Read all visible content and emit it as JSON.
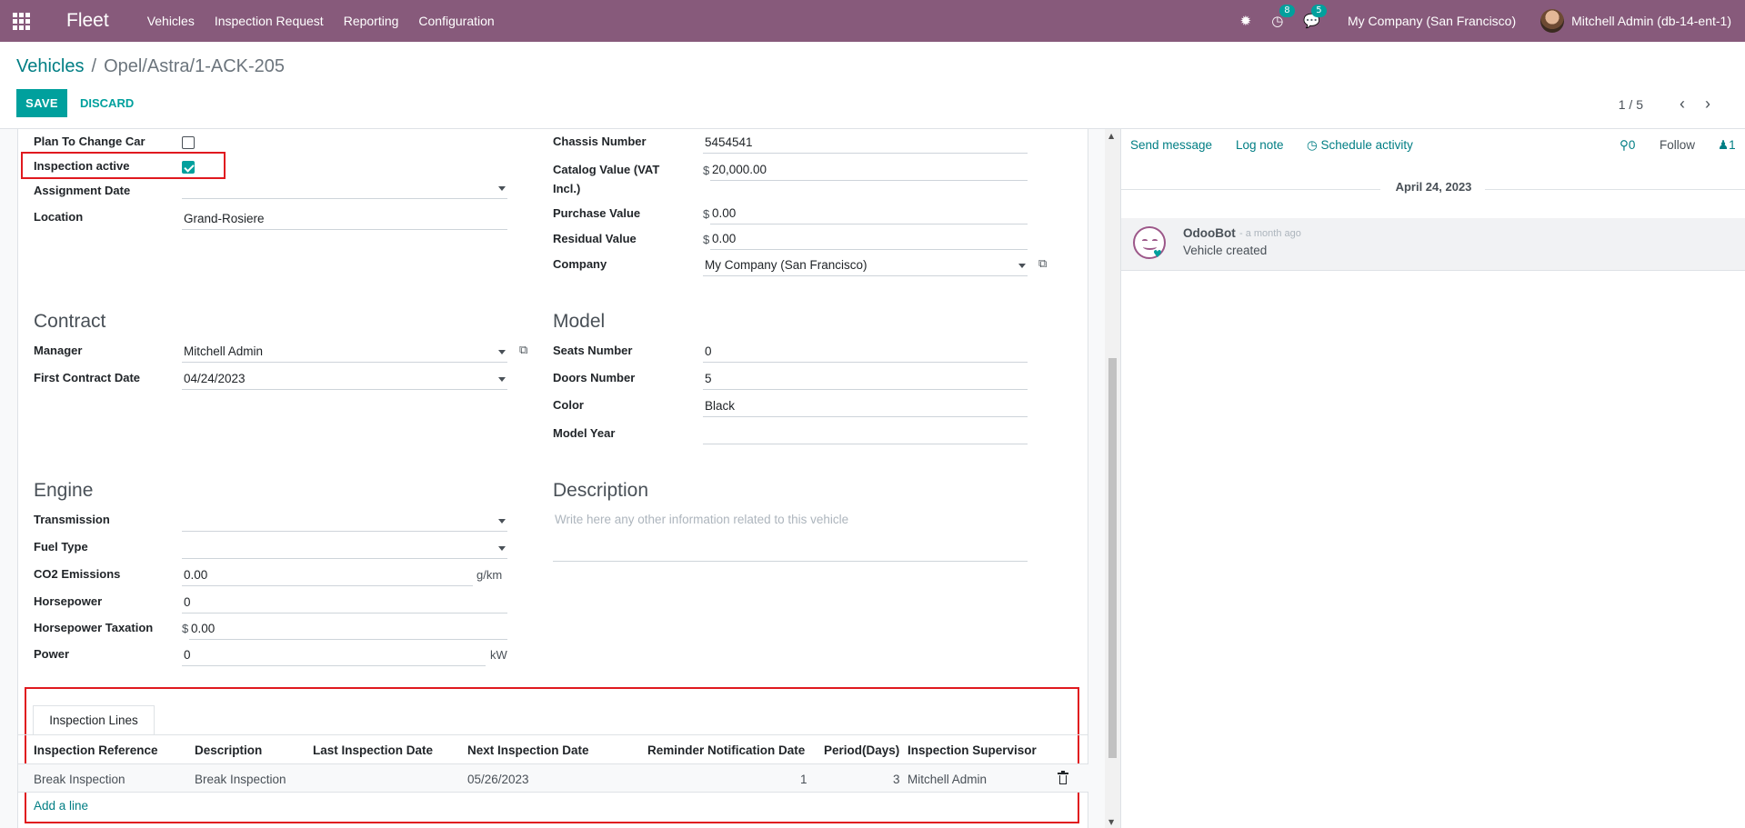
{
  "navbar": {
    "brand": "Fleet",
    "menu": [
      "Vehicles",
      "Inspection Request",
      "Reporting",
      "Configuration"
    ],
    "activity_count": "8",
    "message_count": "5",
    "company": "My Company (San Francisco)",
    "user": "Mitchell Admin (db-14-ent-1)"
  },
  "breadcrumb": {
    "parent": "Vehicles",
    "separator": "/",
    "current": "Opel/Astra/1-ACK-205"
  },
  "buttons": {
    "save": "SAVE",
    "discard": "DISCARD"
  },
  "pager": {
    "value": "1 / 5",
    "prev": "‹",
    "next": "›"
  },
  "left_top": {
    "plan_change_label": "Plan To Change Car",
    "inspection_active_label": "Inspection active",
    "assignment_date_label": "Assignment Date",
    "location_label": "Location",
    "location_value": "Grand-Rosiere"
  },
  "right_top": {
    "chassis_label": "Chassis Number",
    "chassis_value": "5454541",
    "catalog_label_1": "Catalog Value (VAT",
    "catalog_label_2": "Incl.)",
    "currency": "$",
    "catalog_value": "20,000.00",
    "purchase_label": "Purchase Value",
    "purchase_value": "0.00",
    "residual_label": "Residual Value",
    "residual_value": "0.00",
    "company_label": "Company",
    "company_value": "My Company (San Francisco)"
  },
  "contract": {
    "title": "Contract",
    "manager_label": "Manager",
    "manager_value": "Mitchell Admin",
    "first_date_label": "First Contract Date",
    "first_date_value": "04/24/2023"
  },
  "model": {
    "title": "Model",
    "seats_label": "Seats Number",
    "seats_value": "0",
    "doors_label": "Doors Number",
    "doors_value": "5",
    "color_label": "Color",
    "color_value": "Black",
    "year_label": "Model Year",
    "year_value": ""
  },
  "engine": {
    "title": "Engine",
    "transmission_label": "Transmission",
    "fuel_label": "Fuel Type",
    "co2_label": "CO2 Emissions",
    "co2_value": "0.00",
    "co2_unit": "g/km",
    "hp_label": "Horsepower",
    "hp_value": "0",
    "hp_tax_label": "Horsepower Taxation",
    "hp_tax_value": "0.00",
    "power_label": "Power",
    "power_value": "0",
    "power_unit": "kW"
  },
  "description": {
    "title": "Description",
    "placeholder": "Write here any other information related to this vehicle"
  },
  "inspection": {
    "tab": "Inspection Lines",
    "columns": [
      "Inspection Reference",
      "Description",
      "Last Inspection Date",
      "Next Inspection Date",
      "Reminder Notification Date",
      "Period(Days)",
      "Inspection Supervisor"
    ],
    "rows": [
      [
        "Break Inspection",
        "Break Inspection",
        "",
        "05/26/2023",
        "1",
        "3",
        "Mitchell Admin"
      ]
    ],
    "add_line": "Add a line"
  },
  "chatter": {
    "send_message": "Send message",
    "log_note": "Log note",
    "schedule_activity": "Schedule activity",
    "attachments": "0",
    "follow": "Follow",
    "followers": "1",
    "date": "April 24, 2023",
    "message_author": "OdooBot",
    "message_time": "- a month ago",
    "message_body": "Vehicle created"
  },
  "colors": {
    "navbar": "#875A7B",
    "primary": "#00A09D",
    "link": "#017e84",
    "highlight": "#e0191f"
  }
}
